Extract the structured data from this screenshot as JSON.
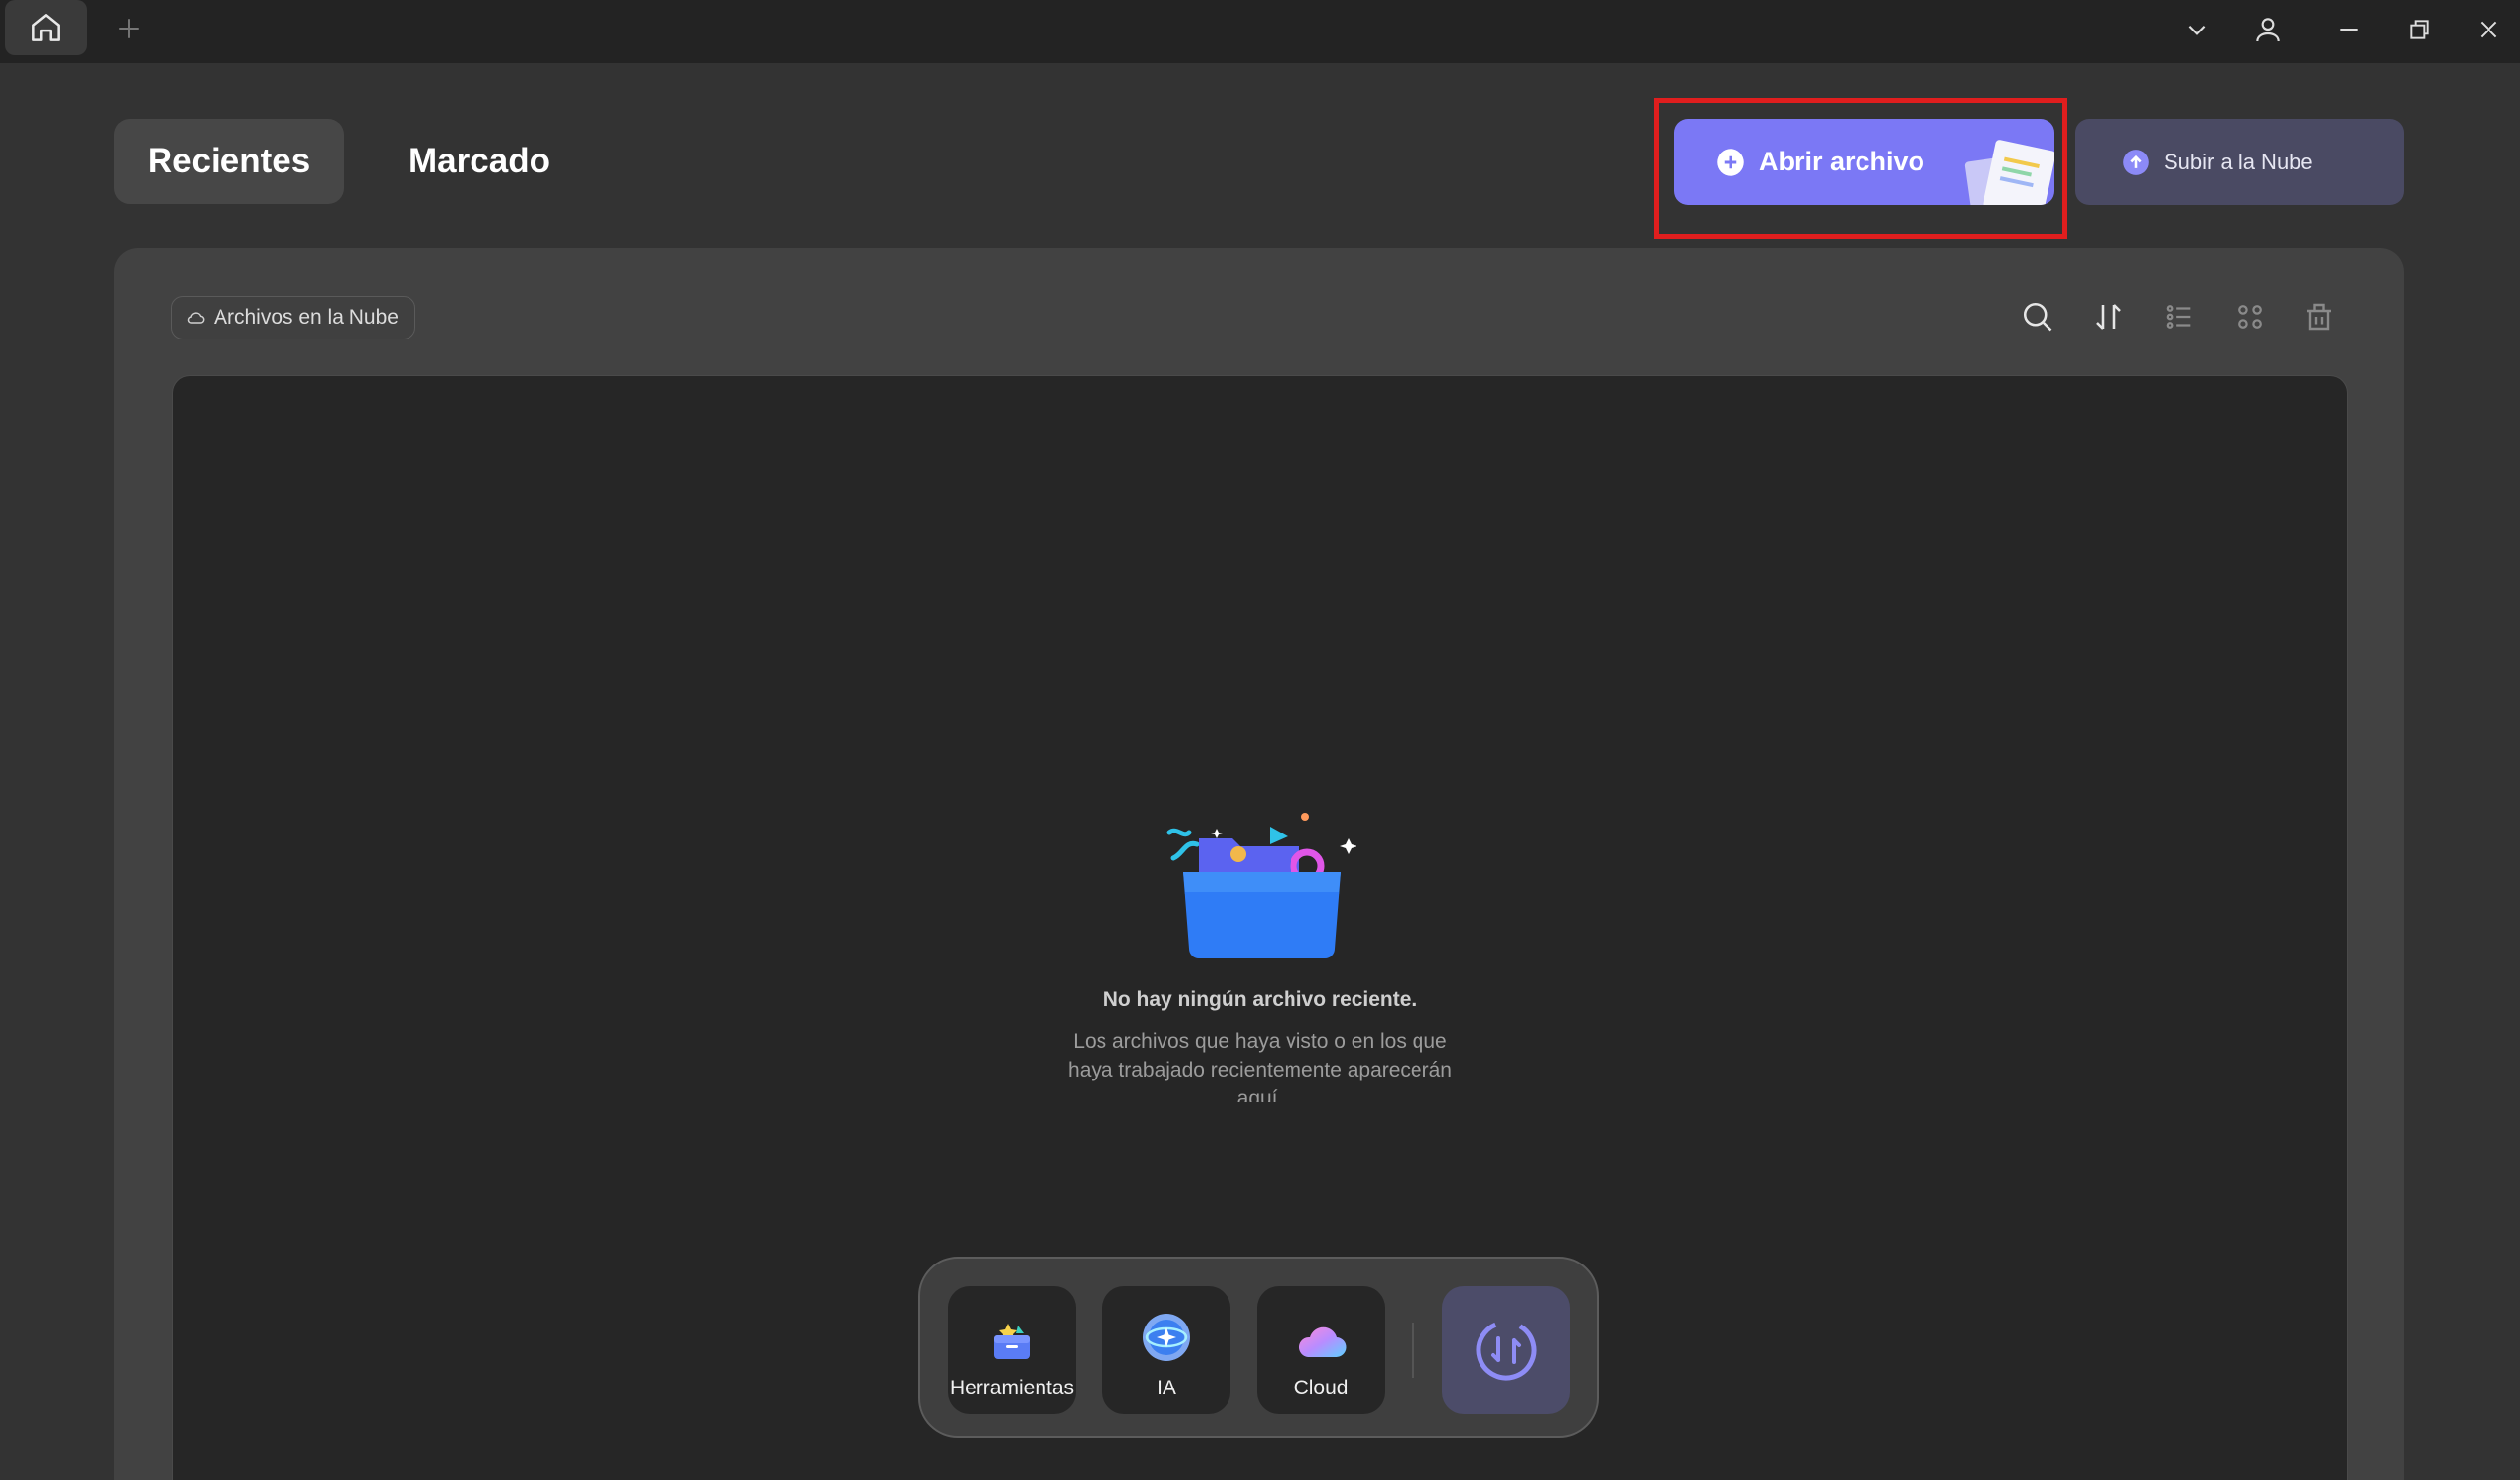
{
  "titlebar": {
    "home_icon": "home-icon",
    "new_tab_icon": "plus-icon",
    "controls": [
      "chevron-down-icon",
      "user-icon",
      "minimize-icon",
      "restore-icon",
      "close-icon"
    ]
  },
  "nav": {
    "tabs": [
      {
        "label": "Recientes",
        "active": true
      },
      {
        "label": "Marcado",
        "active": false
      }
    ]
  },
  "actions": {
    "open_file_label": "Abrir archivo",
    "upload_cloud_label": "Subir a la Nube"
  },
  "toolbar": {
    "cloud_files_chip": "Archivos en la Nube",
    "icons": [
      "search-icon",
      "sort-icon",
      "list-view-icon",
      "grid-view-icon",
      "delete-icon"
    ]
  },
  "empty_state": {
    "title": "No hay ningún archivo reciente.",
    "description": "Los archivos que haya visto o en los que haya trabajado recientemente aparecerán aquí."
  },
  "dock": {
    "items": [
      {
        "label": "Herramientas",
        "icon": "toolbox-icon"
      },
      {
        "label": "IA",
        "icon": "ai-icon"
      },
      {
        "label": "Cloud",
        "icon": "cloud-icon"
      }
    ],
    "sync_icon": "sync-icon"
  },
  "colors": {
    "accent": "#7b78f5",
    "highlight": "#e01e1e",
    "background": "#333333",
    "panel": "#424242",
    "content": "#262626"
  }
}
